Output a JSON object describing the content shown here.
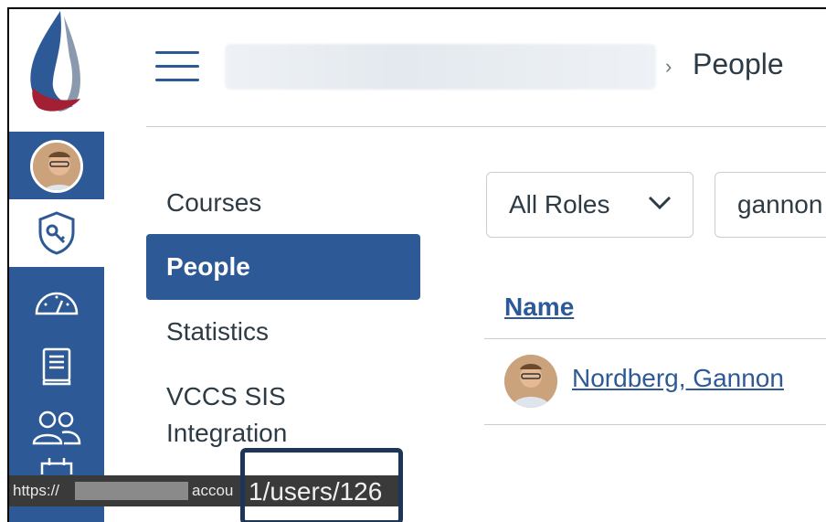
{
  "header": {
    "breadcrumb_separator": "›",
    "current_page": "People"
  },
  "section_nav": {
    "items": [
      {
        "label": "Courses",
        "active": false
      },
      {
        "label": "People",
        "active": true
      },
      {
        "label": "Statistics",
        "active": false
      },
      {
        "label": "VCCS SIS",
        "active": false
      },
      {
        "label": "Integration",
        "active": false
      }
    ]
  },
  "filters": {
    "role_select_value": "All Roles",
    "search_value": "gannon"
  },
  "table": {
    "column_header": "Name",
    "rows": [
      {
        "name": "Nordberg, Gannon"
      }
    ]
  },
  "status_bar": {
    "prefix": "https://",
    "middle": "accou",
    "end": "1/users/126"
  },
  "colors": {
    "brand_blue": "#2d5a96",
    "text": "#2d3b45",
    "border": "#c7cdd1"
  }
}
